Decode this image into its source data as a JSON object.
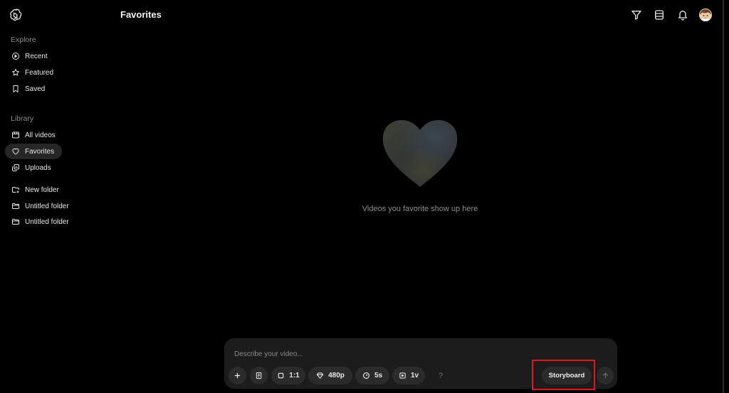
{
  "app": {
    "logo_icon": "openai-logo-icon"
  },
  "header": {
    "title": "Favorites"
  },
  "sidebar": {
    "explore_label": "Explore",
    "explore_items": [
      {
        "label": "Recent",
        "icon": "play-circle-icon"
      },
      {
        "label": "Featured",
        "icon": "star-icon"
      },
      {
        "label": "Saved",
        "icon": "bookmark-icon"
      }
    ],
    "library_label": "Library",
    "library_items": [
      {
        "label": "All videos",
        "icon": "video-library-icon"
      },
      {
        "label": "Favorites",
        "icon": "heart-icon",
        "active": true
      },
      {
        "label": "Uploads",
        "icon": "uploads-icon"
      }
    ],
    "folder_items": [
      {
        "label": "New folder",
        "icon": "folder-plus-icon"
      },
      {
        "label": "Untitled folder",
        "icon": "folder-icon"
      },
      {
        "label": "Untitled folder",
        "icon": "folder-icon"
      }
    ]
  },
  "topbar": {
    "icons": [
      "filter-icon",
      "list-view-icon",
      "notification-bell-icon",
      "avatar"
    ]
  },
  "empty_state": {
    "message": "Videos you favorite show up here",
    "icon": "heart-icon"
  },
  "composer": {
    "placeholder": "Describe your video...",
    "aspect_ratio": "1:1",
    "resolution": "480p",
    "duration": "5s",
    "variations": "1v",
    "help": "?",
    "storyboard_label": "Storyboard"
  },
  "colors": {
    "background": "#000000",
    "panel": "#1c1c1c",
    "chip": "#2b2b2b",
    "highlight": "#e0161c"
  }
}
